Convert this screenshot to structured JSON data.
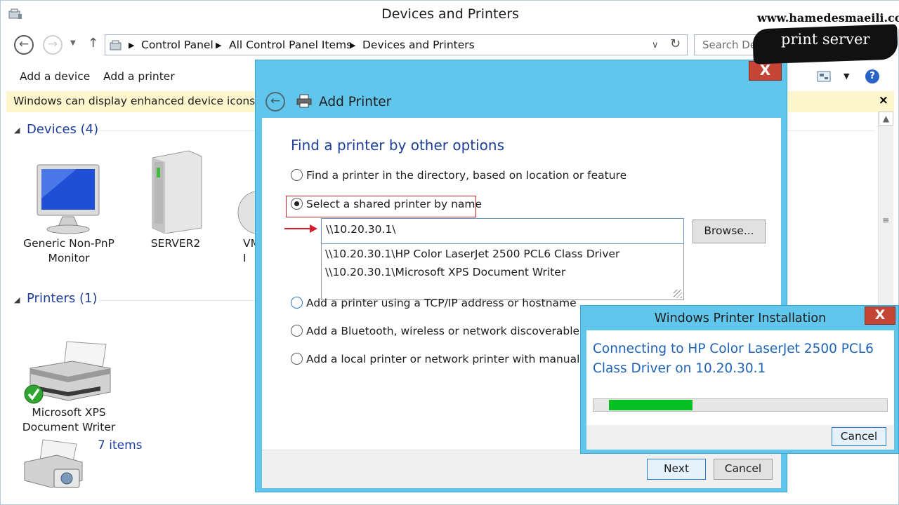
{
  "window": {
    "title": "Devices and Printers",
    "breadcrumbs": [
      "Control Panel",
      "All Control Panel Items",
      "Devices and Printers"
    ],
    "search_placeholder": "Search Devic"
  },
  "command_bar": {
    "add_device": "Add a device",
    "add_printer": "Add a printer"
  },
  "info_bar": {
    "text": "Windows can display enhanced device icons and",
    "close": "×"
  },
  "devices_group": {
    "title": "Devices (4)",
    "items": [
      {
        "label_line1": "Generic Non-PnP",
        "label_line2": "Monitor",
        "icon": "monitor-icon"
      },
      {
        "label_line1": "SERVER2",
        "label_line2": "",
        "icon": "server-icon"
      },
      {
        "label_line1": "VM",
        "label_line2": "I",
        "icon": "vm-icon"
      }
    ]
  },
  "printers_group": {
    "title": "Printers (1)",
    "items": [
      {
        "label_line1": "Microsoft XPS",
        "label_line2": "Document Writer",
        "icon": "printer-icon"
      }
    ],
    "status": "7 items"
  },
  "add_printer_dialog": {
    "title": "Add Printer",
    "close": "X",
    "heading": "Find a printer by other options",
    "options": [
      "Find a printer in the directory, based on location or feature",
      "Select a shared printer by name",
      "Add a printer using a TCP/IP address or hostname",
      "Add a Bluetooth, wireless or network discoverable printer",
      "Add a local printer or network printer with manual settings"
    ],
    "selected_option": 1,
    "name_input_value": "\\\\10.20.30.1\\",
    "suggestions": [
      "\\\\10.20.30.1\\HP Color LaserJet 2500 PCL6 Class Driver",
      "\\\\10.20.30.1\\Microsoft XPS Document Writer"
    ],
    "browse_button": "Browse...",
    "next_button": "Next",
    "cancel_button": "Cancel"
  },
  "installation_dialog": {
    "title": "Windows Printer Installation",
    "close": "X",
    "message": "Connecting to HP Color LaserJet 2500 PCL6 Class Driver on 10.20.30.1",
    "progress_fraction": 0.3,
    "cancel_button": "Cancel"
  },
  "watermark": {
    "url": "www.hamedesmaeili.com",
    "label": "print server"
  },
  "colors": {
    "accent_blue": "#1e3f9a",
    "dialog_frame": "#61c6ec",
    "close_red": "#c44535",
    "progress_green": "#06c124"
  }
}
